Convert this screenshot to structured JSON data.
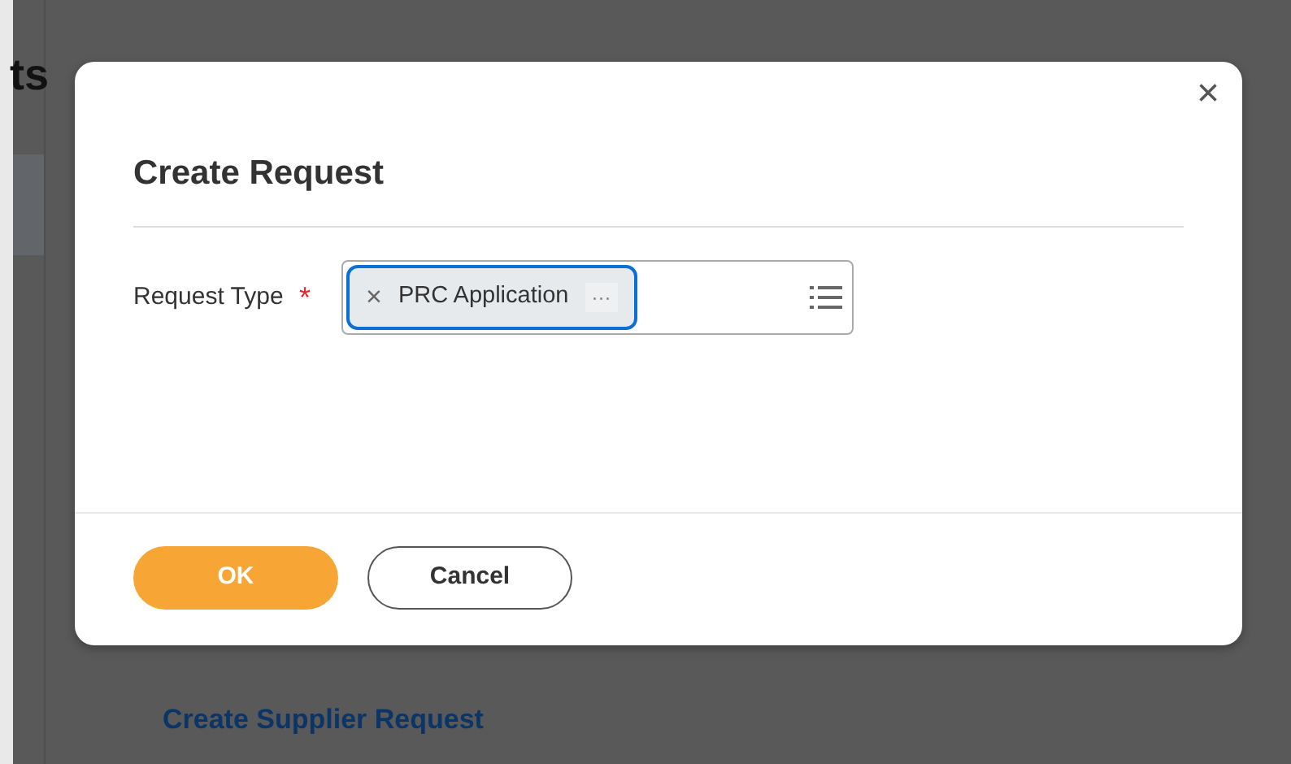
{
  "background_page": {
    "title": "ts",
    "task_link": "Create Supplier Request"
  },
  "dialog": {
    "title": "Create Request",
    "close": "×",
    "fields": [
      {
        "label": "Request Type",
        "required": true,
        "required_mark": "*",
        "kind": "multiselect",
        "chips": [
          {
            "remove": "×",
            "text": "PRC Application",
            "more": "···",
            "focused": true
          }
        ]
      }
    ],
    "buttons": [
      {
        "label": "OK",
        "kind": "primary"
      },
      {
        "label": "Cancel",
        "kind": "secondary"
      }
    ]
  }
}
